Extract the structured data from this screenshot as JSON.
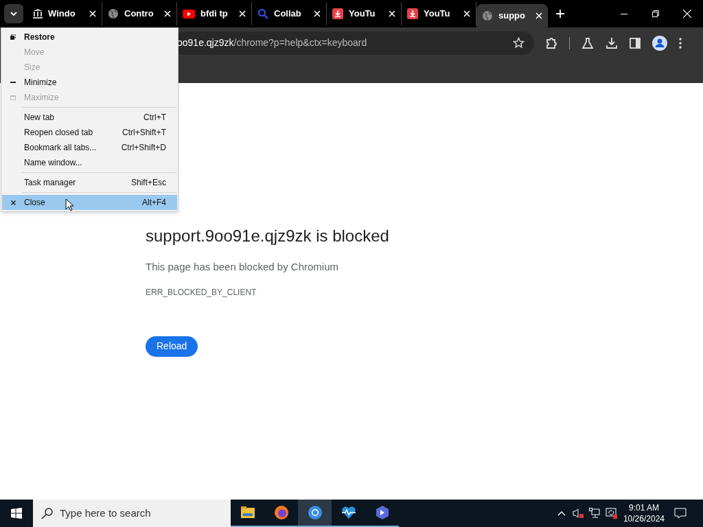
{
  "tabs": [
    {
      "kind": "bank",
      "label": "Windo",
      "selected": false
    },
    {
      "kind": "globe",
      "label": "Contro",
      "selected": false
    },
    {
      "kind": "video",
      "label": "bfdi tp",
      "selected": false
    },
    {
      "kind": "search",
      "label": "Collab",
      "selected": false
    },
    {
      "kind": "download",
      "label": "YouTu",
      "selected": false
    },
    {
      "kind": "download",
      "label": "YouTu",
      "selected": false
    },
    {
      "kind": "globe",
      "label": "suppo",
      "selected": true
    }
  ],
  "address": {
    "host": "oo91e.qjz9zk",
    "path": "/chrome?p=help&ctx=keyboard"
  },
  "system_menu": [
    {
      "kind": "restore",
      "label": "Restore",
      "disabled": false,
      "selected": false
    },
    {
      "kind": "plain",
      "label": "Move",
      "disabled": true,
      "selected": false
    },
    {
      "kind": "plain",
      "label": "Size",
      "disabled": true,
      "selected": false
    },
    {
      "kind": "minimize",
      "label": "Minimize",
      "disabled": false,
      "selected": false
    },
    {
      "kind": "maximize",
      "label": "Maximize",
      "disabled": true,
      "selected": false
    },
    {
      "kind": "separator"
    },
    {
      "kind": "plain",
      "label": "New tab",
      "shortcut": "Ctrl+T",
      "disabled": false,
      "selected": false
    },
    {
      "kind": "plain",
      "label": "Reopen closed tab",
      "shortcut": "Ctrl+Shift+T",
      "disabled": false,
      "selected": false
    },
    {
      "kind": "plain",
      "label": "Bookmark all tabs...",
      "shortcut": "Ctrl+Shift+D",
      "disabled": false,
      "selected": false
    },
    {
      "kind": "plain",
      "label": "Name window...",
      "disabled": false,
      "selected": false
    },
    {
      "kind": "separator"
    },
    {
      "kind": "plain",
      "label": "Task manager",
      "shortcut": "Shift+Esc",
      "disabled": false,
      "selected": false
    },
    {
      "kind": "separator"
    },
    {
      "kind": "close",
      "label": "Close",
      "shortcut": "Alt+F4",
      "disabled": false,
      "selected": true
    }
  ],
  "error": {
    "title": "support.9oo91e.qjz9zk is blocked",
    "message": "This page has been blocked by Chromium",
    "code": "ERR_BLOCKED_BY_CLIENT",
    "button": "Reload"
  },
  "taskbar": {
    "search_placeholder": "Type here to search",
    "apps": [
      {
        "kind": "folder",
        "selected": false
      },
      {
        "kind": "firefox",
        "selected": false
      },
      {
        "kind": "chromium",
        "selected": true
      },
      {
        "kind": "heart",
        "selected": false
      },
      {
        "kind": "photos",
        "selected": false
      }
    ],
    "time": "9:01 AM",
    "date": "10/26/2024"
  }
}
